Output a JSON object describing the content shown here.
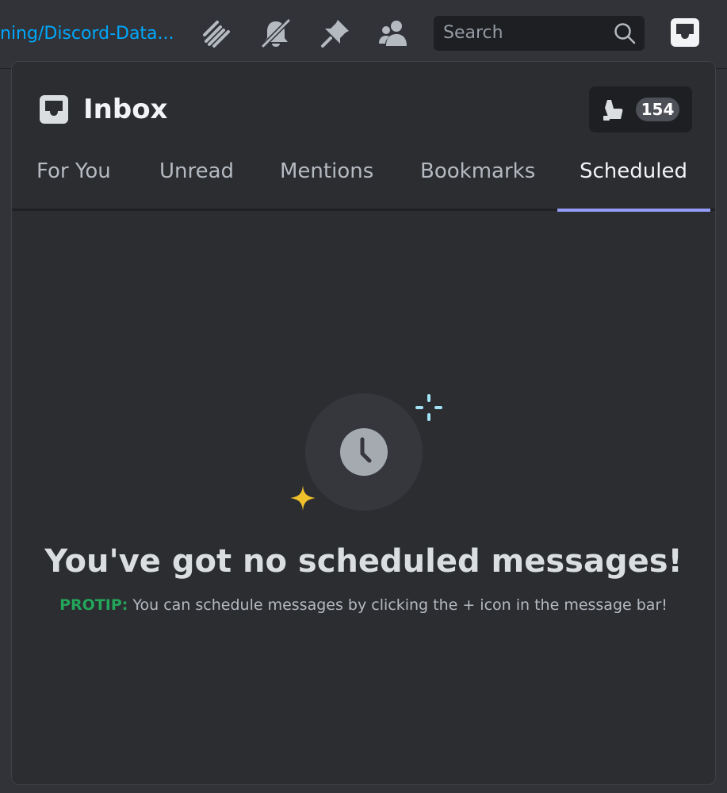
{
  "topbar": {
    "channel_link": "ning/Discord-Data...",
    "search_placeholder": "Search",
    "icons": [
      "threads-icon",
      "bell-muted-icon",
      "pin-icon",
      "members-icon",
      "search-icon",
      "inbox-icon"
    ]
  },
  "inbox": {
    "title": "Inbox",
    "count": "154",
    "tabs": [
      {
        "label": "For You",
        "active": false
      },
      {
        "label": "Unread",
        "active": false
      },
      {
        "label": "Mentions",
        "active": false
      },
      {
        "label": "Bookmarks",
        "active": false
      },
      {
        "label": "Scheduled",
        "active": true
      }
    ],
    "empty_state": {
      "title": "You've got no scheduled messages!",
      "protip_label": "PROTIP:",
      "protip_text": " You can schedule messages by clicking the + icon in the message bar!"
    }
  },
  "colors": {
    "accent": "#949cf7",
    "link": "#00a8fc",
    "protip": "#23a55a",
    "sparkle_yellow": "#f0c02a",
    "sparkle_blue": "#a3e3f5"
  }
}
